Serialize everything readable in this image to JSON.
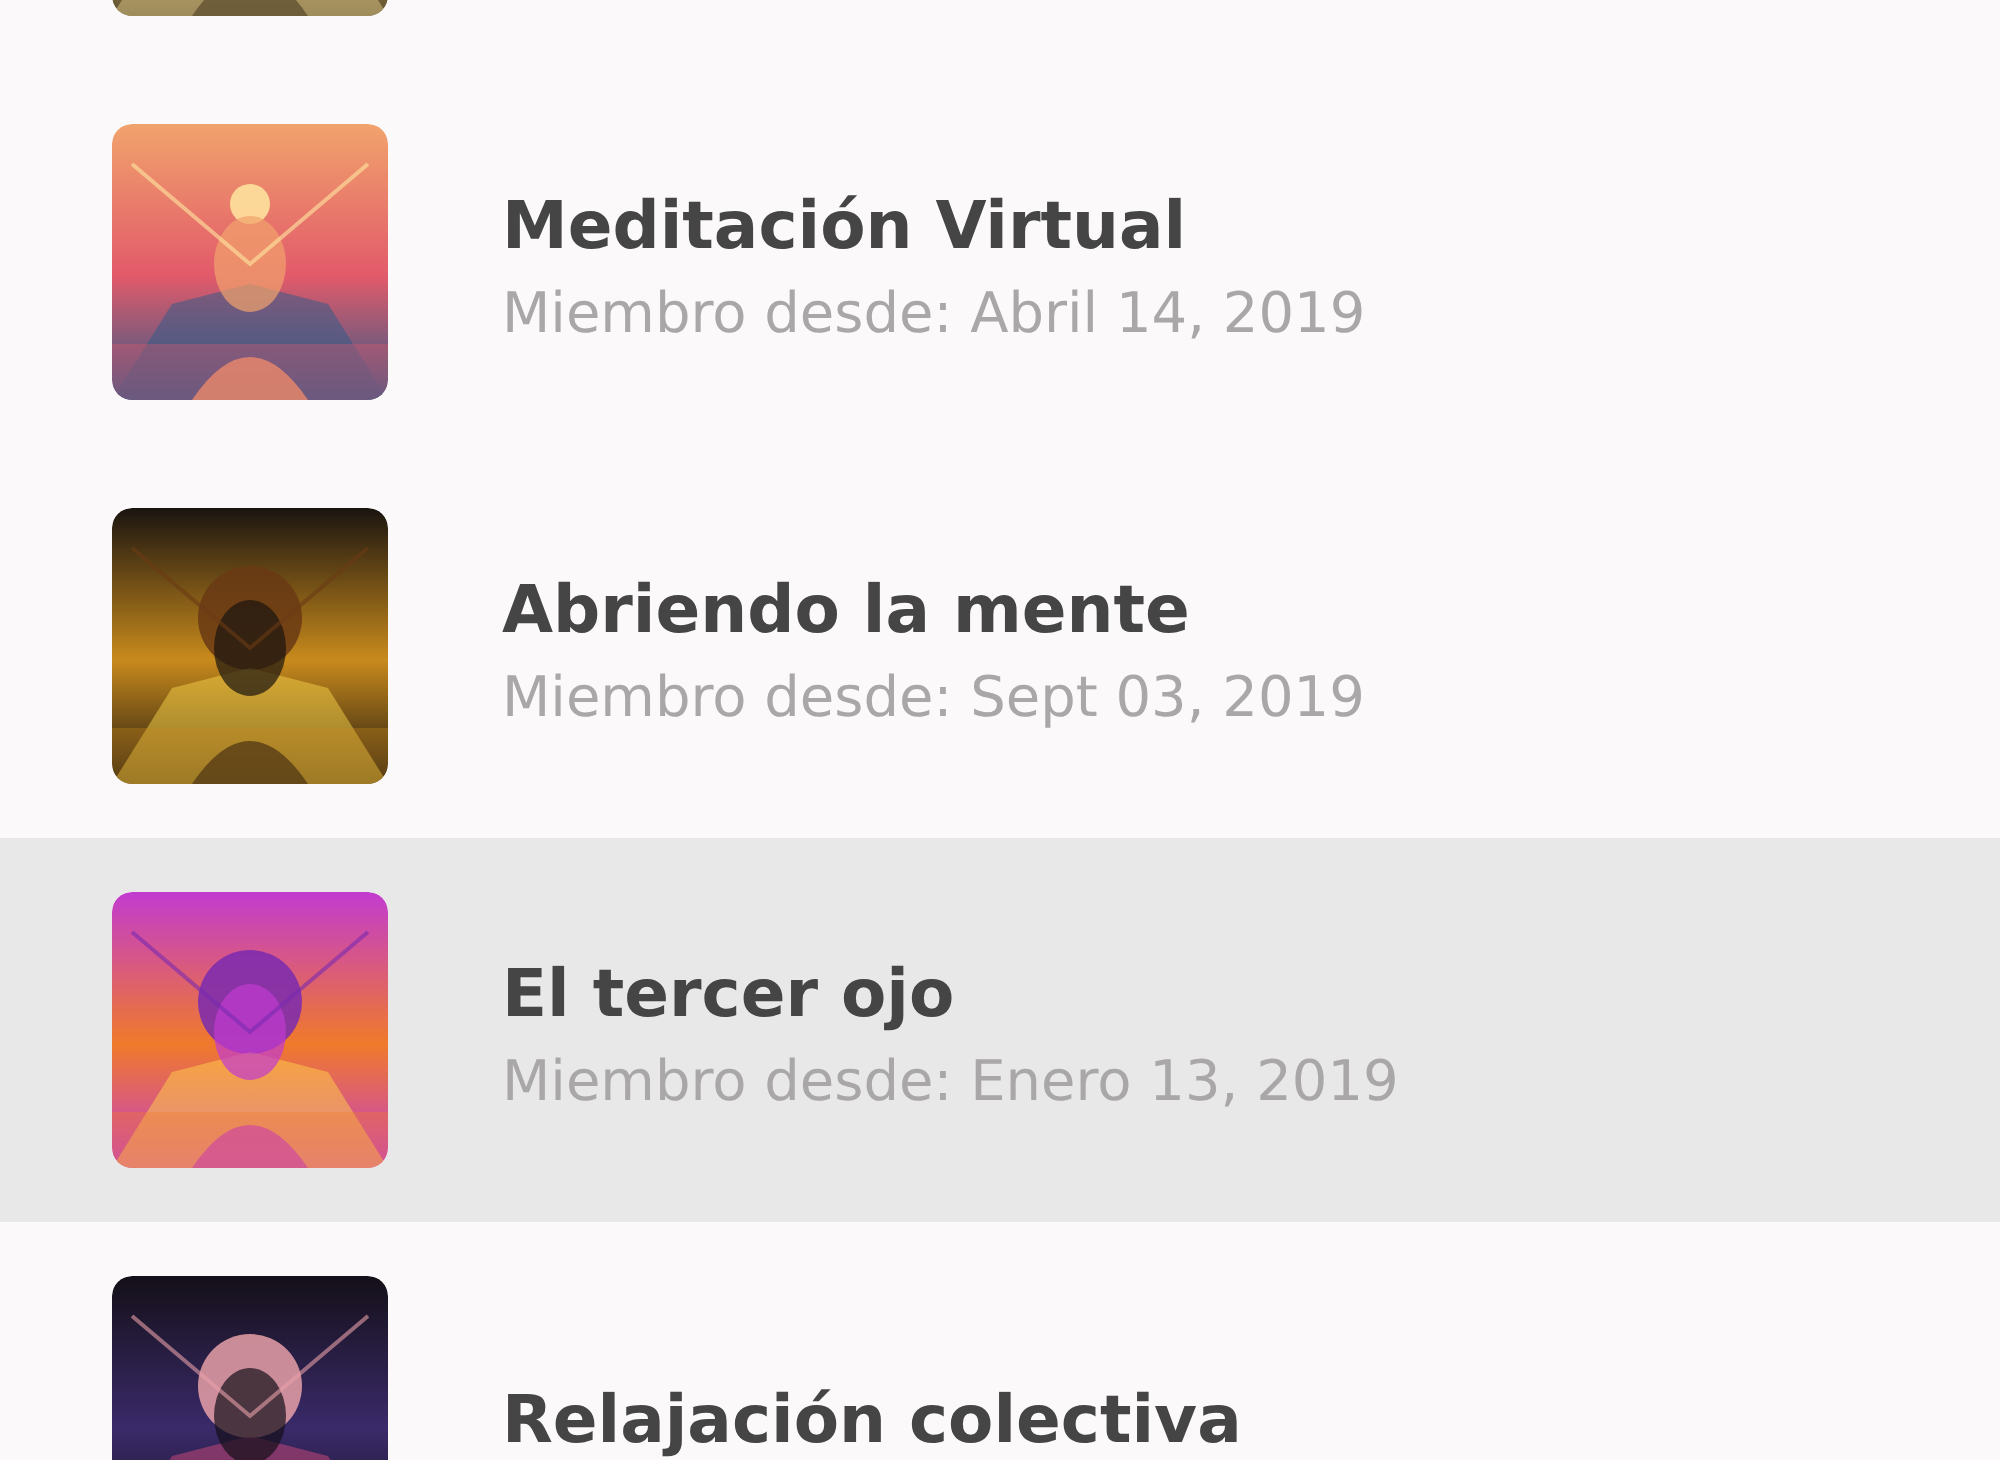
{
  "groups": [
    {
      "kind": "picture"
    },
    {
      "kind": "group",
      "title": "Meditación Virtual",
      "subtitle": "Miembro desde: Abril 14, 2019",
      "selected": false
    },
    {
      "kind": "group",
      "title": "Abriendo la mente",
      "subtitle": "Miembro desde: Sept 03, 2019",
      "selected": false
    },
    {
      "kind": "group",
      "title": "El tercer ojo",
      "subtitle": "Miembro desde: Enero 13, 2019",
      "selected": true
    },
    {
      "kind": "group",
      "title": "Relajación colectiva",
      "selected": false
    }
  ]
}
